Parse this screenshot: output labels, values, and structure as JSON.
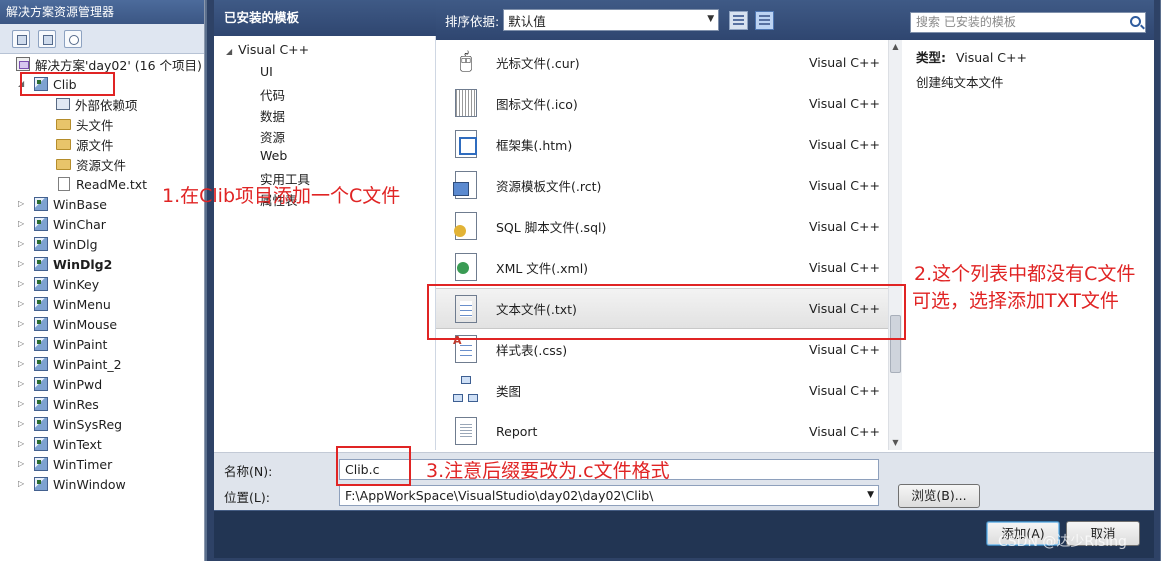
{
  "solution_explorer": {
    "title": "解决方案资源管理器",
    "solution": "解决方案'day02' (16 个项目)",
    "clib": {
      "name": "Clib",
      "children": [
        "外部依赖项",
        "头文件",
        "源文件",
        "资源文件",
        "ReadMe.txt"
      ]
    },
    "projects": [
      "WinBase",
      "WinChar",
      "WinDlg",
      "WinDlg2",
      "WinKey",
      "WinMenu",
      "WinMouse",
      "WinPaint",
      "WinPaint_2",
      "WinPwd",
      "WinRes",
      "WinSysReg",
      "WinText",
      "WinTimer",
      "WinWindow"
    ],
    "bold_project": "WinDlg2"
  },
  "dialog": {
    "installed_header": "已安装的模板",
    "category_root": "Visual C++",
    "categories": [
      "UI",
      "代码",
      "数据",
      "资源",
      "Web",
      "实用工具",
      "属性表"
    ],
    "sort_label": "排序依据:",
    "sort_value": "默认值",
    "search_placeholder": "搜索 已安装的模板",
    "templates": [
      {
        "name": "光标文件(.cur)",
        "type": "Visual C++",
        "icon": "cursor-file-icon"
      },
      {
        "name": "图标文件(.ico)",
        "type": "Visual C++",
        "icon": "icon-file-icon"
      },
      {
        "name": "框架集(.htm)",
        "type": "Visual C++",
        "icon": "frameset-icon"
      },
      {
        "name": "资源模板文件(.rct)",
        "type": "Visual C++",
        "icon": "resource-template-icon"
      },
      {
        "name": "SQL 脚本文件(.sql)",
        "type": "Visual C++",
        "icon": "sql-script-icon"
      },
      {
        "name": "XML 文件(.xml)",
        "type": "Visual C++",
        "icon": "xml-file-icon"
      },
      {
        "name": "文本文件(.txt)",
        "type": "Visual C++",
        "icon": "text-file-icon",
        "selected": true
      },
      {
        "name": "样式表(.css)",
        "type": "Visual C++",
        "icon": "stylesheet-icon"
      },
      {
        "name": "类图",
        "type": "Visual C++",
        "icon": "class-diagram-icon"
      },
      {
        "name": "Report",
        "type": "Visual C++",
        "icon": "report-icon"
      }
    ],
    "detail": {
      "type_label": "类型:",
      "type_value": "Visual C++",
      "description": "创建纯文本文件"
    },
    "name_label": "名称(N):",
    "name_value": "Clib.c",
    "location_label": "位置(L):",
    "location_value": "F:\\AppWorkSpace\\VisualStudio\\day02\\day02\\Clib\\",
    "browse_label": "浏览(B)...",
    "add_label": "添加(A)",
    "cancel_label": "取消"
  },
  "annotations": {
    "note1": "1.在Clib项目添加一个C文件",
    "note2_line1": "2.这个列表中都没有C文件",
    "note2_line2": "可选，选择添加TXT文件",
    "note3": "3.注意后缀要改为.c文件格式",
    "color": "#e02424"
  },
  "watermark": "CSDN @达少Rising"
}
